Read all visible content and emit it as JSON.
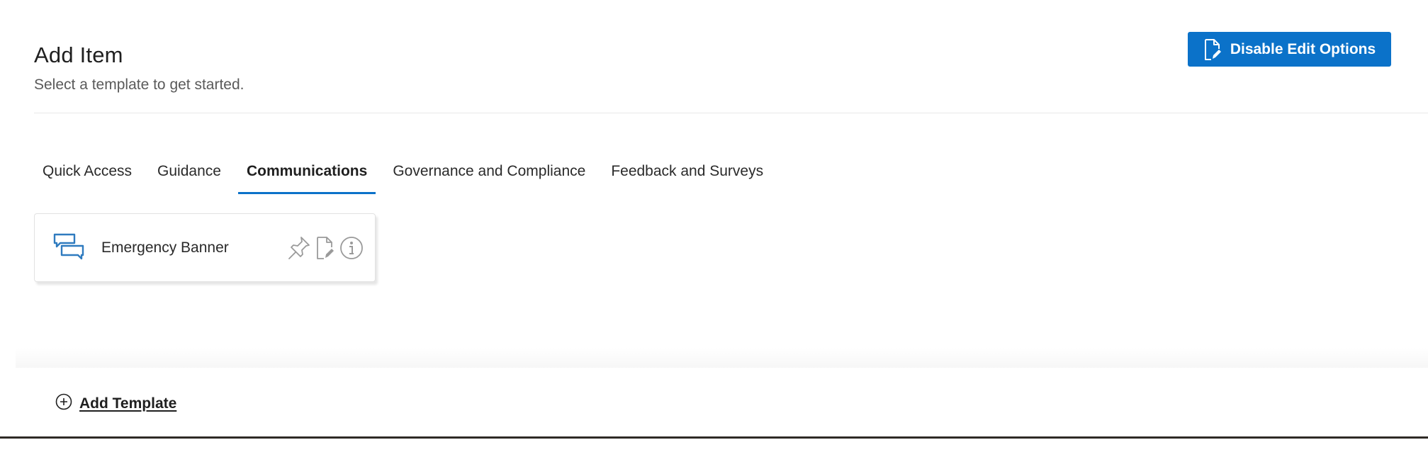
{
  "header": {
    "title": "Add Item",
    "subtitle": "Select a template to get started."
  },
  "actions": {
    "disable_edit_label": "Disable Edit Options"
  },
  "tabs": [
    {
      "label": "Quick Access",
      "active": false
    },
    {
      "label": "Guidance",
      "active": false
    },
    {
      "label": "Communications",
      "active": true
    },
    {
      "label": "Governance and Compliance",
      "active": false
    },
    {
      "label": "Feedback and Surveys",
      "active": false
    }
  ],
  "card": {
    "label": "Emergency Banner",
    "icon": "chat-bubbles-icon",
    "action_icons": [
      "pin-icon",
      "edit-document-icon",
      "info-icon"
    ]
  },
  "footer": {
    "add_template_label": "Add Template",
    "icon": "plus-circle-icon"
  },
  "colors": {
    "accent": "#0b72c9",
    "text": "#1f1f1f",
    "muted": "#5a5a5a",
    "icon_gray": "#9a9a9a",
    "card_icon": "#2f7bbf"
  }
}
